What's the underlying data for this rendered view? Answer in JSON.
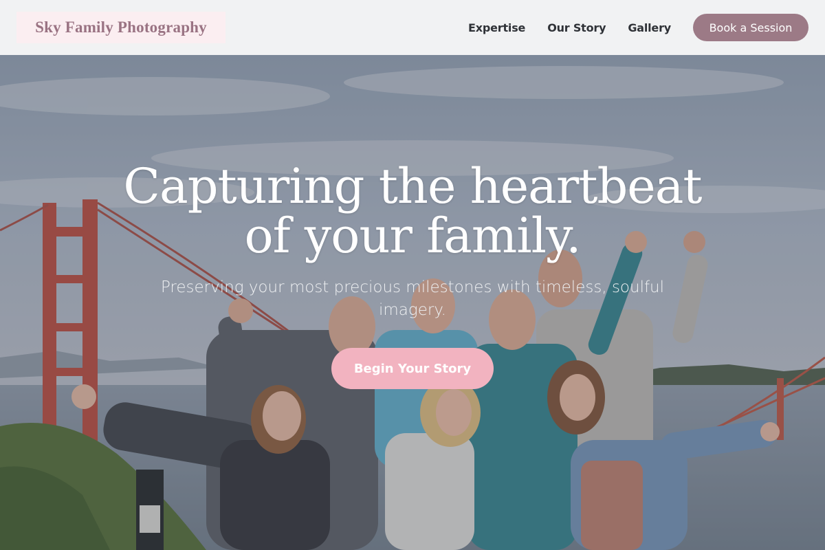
{
  "header": {
    "logo": "Sky Family Photography",
    "nav": [
      {
        "label": "Expertise"
      },
      {
        "label": "Our Story"
      },
      {
        "label": "Gallery"
      }
    ],
    "cta_label": "Book a Session"
  },
  "hero": {
    "title_line1": "Capturing the heartbeat",
    "title_line2": "of your family.",
    "subtitle": "Preserving your most precious milestones with timeless, soulful imagery.",
    "cta_label": "Begin Your Story",
    "background": "group of friends cheering in front of the Golden Gate Bridge"
  },
  "colors": {
    "header_bg": "#f1f2f3",
    "logo_bg": "#fbeef1",
    "logo_text": "#9a7383",
    "nav_text": "#2f3237",
    "book_button": "#9c7a86",
    "hero_button": "#f2b3c0"
  }
}
